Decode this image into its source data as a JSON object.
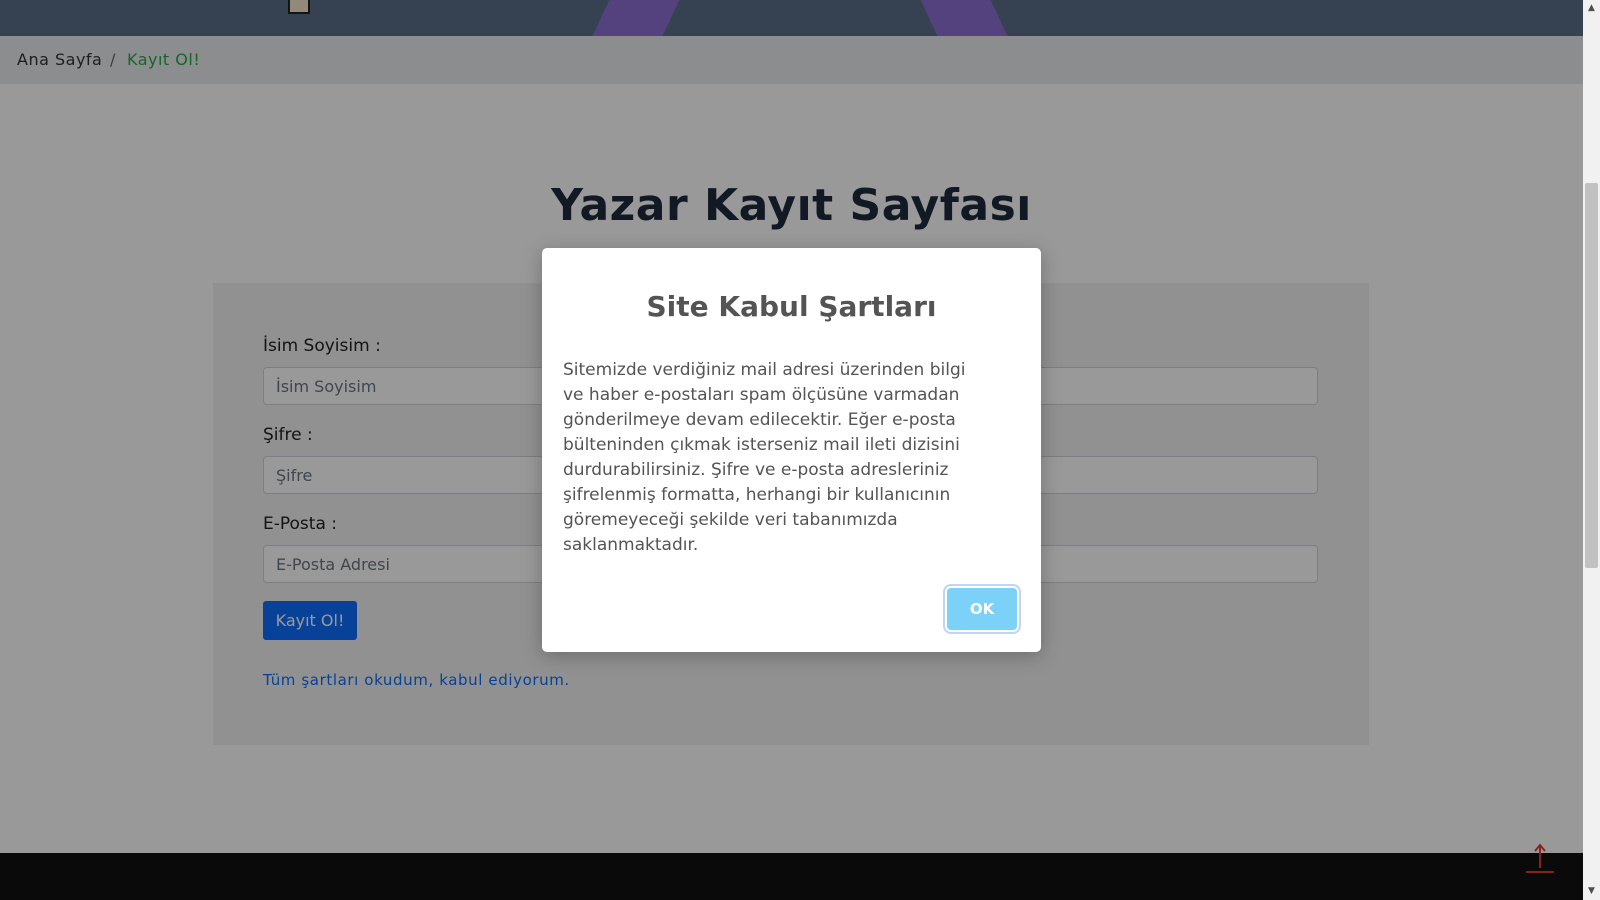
{
  "breadcrumb": {
    "home": "Ana Sayfa",
    "separator": "/",
    "current": "Kayıt Ol!"
  },
  "page": {
    "title": "Yazar Kayıt Sayfası"
  },
  "form": {
    "name_label": "İsim Soyisim :",
    "name_placeholder": "İsim Soyisim",
    "password_label": "Şifre :",
    "password_placeholder": "Şifre",
    "email_label": "E-Posta :",
    "email_placeholder": "E-Posta Adresi",
    "submit_label": "Kayıt Ol!",
    "terms_link": "Tüm şartları okudum, kabul ediyorum."
  },
  "modal": {
    "title": "Site Kabul Şartları",
    "text": "Sitemizde verdiğiniz mail adresi üzerinden bilgi ve haber e-postaları spam ölçüsüne varmadan gönderilmeye devam edilecektir. Eğer e-posta bülteninden çıkmak isterseniz mail ileti dizisini durdurabilirsiniz. Şifre ve e-posta adresleriniz şifrelenmiş formatta, herhangi bir kullanıcının göremeyeceği şekilde veri tabanımızda saklanmaktadır.",
    "ok_label": "OK"
  },
  "icons": {
    "scroll_top": "arrow-up-icon"
  },
  "colors": {
    "primary": "#0d6efd",
    "breadcrumb_active": "#28a745",
    "ok_button": "#7cd1f9",
    "scroll_top": "#e53935"
  }
}
